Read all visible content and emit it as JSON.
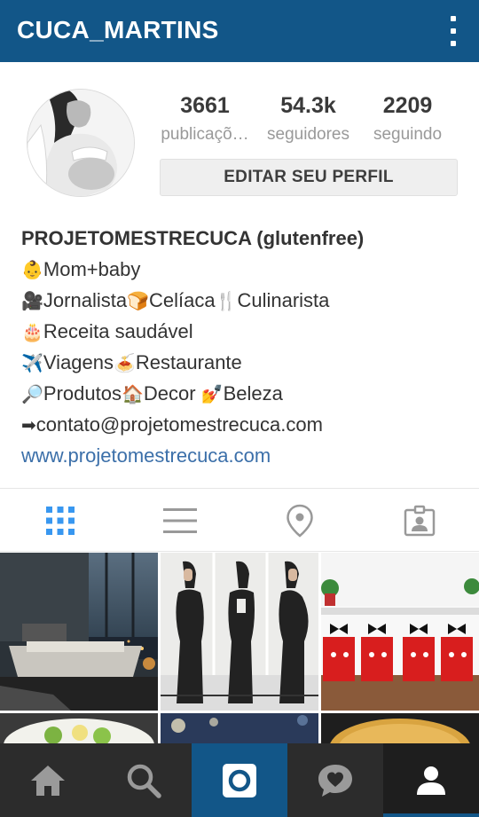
{
  "header": {
    "username": "CUCA_MARTINS",
    "more_icon": "more-vertical-icon"
  },
  "profile": {
    "stats": [
      {
        "value": "3661",
        "label": "publicaçõ…"
      },
      {
        "value": "54.3k",
        "label": "seguidores"
      },
      {
        "value": "2209",
        "label": "seguindo"
      }
    ],
    "edit_button": "EDITAR SEU PERFIL"
  },
  "bio": {
    "name": "PROJETOMESTRECUCA (glutenfree)",
    "lines": [
      {
        "emoji1": "👶",
        "text1": "Mom+baby"
      },
      {
        "emoji1": "🎥",
        "text1": "Jornalista",
        "emoji2": "🍞",
        "text2": "Celíaca",
        "emoji3": "🍴",
        "text3": "Culinarista"
      },
      {
        "emoji1": "🎂",
        "text1": "Receita saudável"
      },
      {
        "emoji1": "✈️",
        "text1": "Viagens",
        "emoji2": "🍝",
        "text2": "Restaurante"
      },
      {
        "emoji1": "🔎",
        "text1": "Produtos",
        "emoji2": "🏠",
        "text2": "Decor ",
        "emoji3": "💅",
        "text3": "Beleza"
      },
      {
        "emoji1": "➡",
        "text1": "contato@projetomestrecuca.com"
      }
    ],
    "website": "www.projetomestrecuca.com"
  },
  "tabs": [
    {
      "name": "grid-view",
      "icon": "grid-icon",
      "active": true
    },
    {
      "name": "list-view",
      "icon": "list-icon",
      "active": false
    },
    {
      "name": "map-view",
      "icon": "location-pin-icon",
      "active": false
    },
    {
      "name": "tagged-view",
      "icon": "tagged-person-icon",
      "active": false
    }
  ],
  "colors": {
    "brand": "#125688",
    "active_tab": "#3897f0",
    "inactive_tab": "#999999",
    "link": "#3b6fa9",
    "nav_bg": "#2c2c2c"
  },
  "bottom_nav": [
    {
      "name": "home",
      "icon": "home-icon"
    },
    {
      "name": "search",
      "icon": "search-icon"
    },
    {
      "name": "camera",
      "icon": "camera-icon"
    },
    {
      "name": "activity",
      "icon": "heart-bubble-icon"
    },
    {
      "name": "profile",
      "icon": "person-icon",
      "active": true
    }
  ]
}
